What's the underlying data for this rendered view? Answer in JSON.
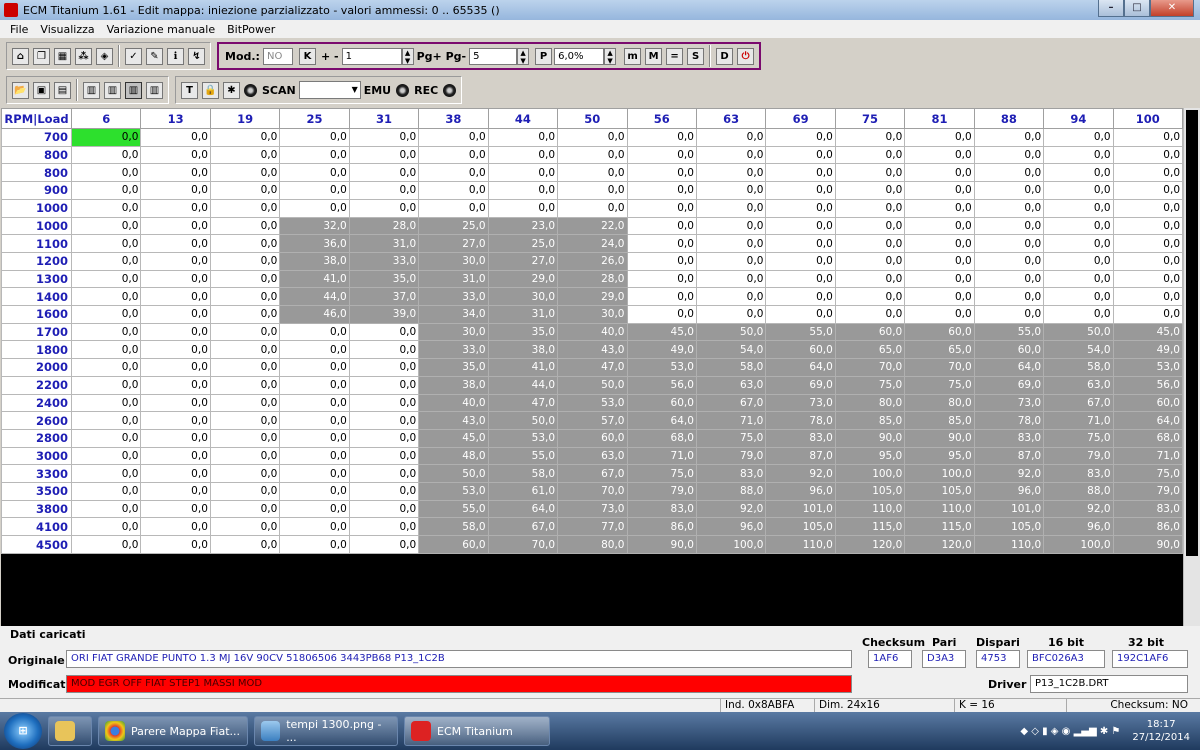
{
  "window": {
    "title": "ECM Titanium 1.61 - Edit mappa: iniezione parzializzato - valori ammessi: 0 .. 65535 ()",
    "min": "–",
    "max": "□",
    "close": "✕"
  },
  "menu": [
    "File",
    "Visualizza",
    "Variazione manuale",
    "BitPower"
  ],
  "toolbar": {
    "mod_label": "Mod.:",
    "mod_value": "NO",
    "k_label": "K",
    "pm_label": "+ -",
    "pm_value": "1",
    "pg_label": "Pg+ Pg-",
    "pg_value": "5",
    "p_label": "P",
    "pct_value": "6,0%",
    "scan_label": "SCAN",
    "emu_label": "EMU",
    "rec_label": "REC"
  },
  "grid": {
    "corner": "RPM|Load",
    "cols": [
      "6",
      "13",
      "19",
      "25",
      "31",
      "38",
      "44",
      "50",
      "56",
      "63",
      "69",
      "75",
      "81",
      "88",
      "94",
      "100"
    ],
    "rpm": [
      "700",
      "800",
      "800",
      "900",
      "1000",
      "1000",
      "1100",
      "1200",
      "1300",
      "1400",
      "1600",
      "1700",
      "1800",
      "2000",
      "2200",
      "2400",
      "2600",
      "2800",
      "3000",
      "3300",
      "3500",
      "3800",
      "4100",
      "4500"
    ],
    "rows": [
      [
        "0,0",
        "0,0",
        "0,0",
        "0,0",
        "0,0",
        "0,0",
        "0,0",
        "0,0",
        "0,0",
        "0,0",
        "0,0",
        "0,0",
        "0,0",
        "0,0",
        "0,0",
        "0,0"
      ],
      [
        "0,0",
        "0,0",
        "0,0",
        "0,0",
        "0,0",
        "0,0",
        "0,0",
        "0,0",
        "0,0",
        "0,0",
        "0,0",
        "0,0",
        "0,0",
        "0,0",
        "0,0",
        "0,0"
      ],
      [
        "0,0",
        "0,0",
        "0,0",
        "0,0",
        "0,0",
        "0,0",
        "0,0",
        "0,0",
        "0,0",
        "0,0",
        "0,0",
        "0,0",
        "0,0",
        "0,0",
        "0,0",
        "0,0"
      ],
      [
        "0,0",
        "0,0",
        "0,0",
        "0,0",
        "0,0",
        "0,0",
        "0,0",
        "0,0",
        "0,0",
        "0,0",
        "0,0",
        "0,0",
        "0,0",
        "0,0",
        "0,0",
        "0,0"
      ],
      [
        "0,0",
        "0,0",
        "0,0",
        "0,0",
        "0,0",
        "0,0",
        "0,0",
        "0,0",
        "0,0",
        "0,0",
        "0,0",
        "0,0",
        "0,0",
        "0,0",
        "0,0",
        "0,0"
      ],
      [
        "0,0",
        "0,0",
        "0,0",
        "32,0",
        "28,0",
        "25,0",
        "23,0",
        "22,0",
        "0,0",
        "0,0",
        "0,0",
        "0,0",
        "0,0",
        "0,0",
        "0,0",
        "0,0"
      ],
      [
        "0,0",
        "0,0",
        "0,0",
        "36,0",
        "31,0",
        "27,0",
        "25,0",
        "24,0",
        "0,0",
        "0,0",
        "0,0",
        "0,0",
        "0,0",
        "0,0",
        "0,0",
        "0,0"
      ],
      [
        "0,0",
        "0,0",
        "0,0",
        "38,0",
        "33,0",
        "30,0",
        "27,0",
        "26,0",
        "0,0",
        "0,0",
        "0,0",
        "0,0",
        "0,0",
        "0,0",
        "0,0",
        "0,0"
      ],
      [
        "0,0",
        "0,0",
        "0,0",
        "41,0",
        "35,0",
        "31,0",
        "29,0",
        "28,0",
        "0,0",
        "0,0",
        "0,0",
        "0,0",
        "0,0",
        "0,0",
        "0,0",
        "0,0"
      ],
      [
        "0,0",
        "0,0",
        "0,0",
        "44,0",
        "37,0",
        "33,0",
        "30,0",
        "29,0",
        "0,0",
        "0,0",
        "0,0",
        "0,0",
        "0,0",
        "0,0",
        "0,0",
        "0,0"
      ],
      [
        "0,0",
        "0,0",
        "0,0",
        "46,0",
        "39,0",
        "34,0",
        "31,0",
        "30,0",
        "0,0",
        "0,0",
        "0,0",
        "0,0",
        "0,0",
        "0,0",
        "0,0",
        "0,0"
      ],
      [
        "0,0",
        "0,0",
        "0,0",
        "0,0",
        "0,0",
        "30,0",
        "35,0",
        "40,0",
        "45,0",
        "50,0",
        "55,0",
        "60,0",
        "60,0",
        "55,0",
        "50,0",
        "45,0"
      ],
      [
        "0,0",
        "0,0",
        "0,0",
        "0,0",
        "0,0",
        "33,0",
        "38,0",
        "43,0",
        "49,0",
        "54,0",
        "60,0",
        "65,0",
        "65,0",
        "60,0",
        "54,0",
        "49,0"
      ],
      [
        "0,0",
        "0,0",
        "0,0",
        "0,0",
        "0,0",
        "35,0",
        "41,0",
        "47,0",
        "53,0",
        "58,0",
        "64,0",
        "70,0",
        "70,0",
        "64,0",
        "58,0",
        "53,0"
      ],
      [
        "0,0",
        "0,0",
        "0,0",
        "0,0",
        "0,0",
        "38,0",
        "44,0",
        "50,0",
        "56,0",
        "63,0",
        "69,0",
        "75,0",
        "75,0",
        "69,0",
        "63,0",
        "56,0"
      ],
      [
        "0,0",
        "0,0",
        "0,0",
        "0,0",
        "0,0",
        "40,0",
        "47,0",
        "53,0",
        "60,0",
        "67,0",
        "73,0",
        "80,0",
        "80,0",
        "73,0",
        "67,0",
        "60,0"
      ],
      [
        "0,0",
        "0,0",
        "0,0",
        "0,0",
        "0,0",
        "43,0",
        "50,0",
        "57,0",
        "64,0",
        "71,0",
        "78,0",
        "85,0",
        "85,0",
        "78,0",
        "71,0",
        "64,0"
      ],
      [
        "0,0",
        "0,0",
        "0,0",
        "0,0",
        "0,0",
        "45,0",
        "53,0",
        "60,0",
        "68,0",
        "75,0",
        "83,0",
        "90,0",
        "90,0",
        "83,0",
        "75,0",
        "68,0"
      ],
      [
        "0,0",
        "0,0",
        "0,0",
        "0,0",
        "0,0",
        "48,0",
        "55,0",
        "63,0",
        "71,0",
        "79,0",
        "87,0",
        "95,0",
        "95,0",
        "87,0",
        "79,0",
        "71,0"
      ],
      [
        "0,0",
        "0,0",
        "0,0",
        "0,0",
        "0,0",
        "50,0",
        "58,0",
        "67,0",
        "75,0",
        "83,0",
        "92,0",
        "100,0",
        "100,0",
        "92,0",
        "83,0",
        "75,0"
      ],
      [
        "0,0",
        "0,0",
        "0,0",
        "0,0",
        "0,0",
        "53,0",
        "61,0",
        "70,0",
        "79,0",
        "88,0",
        "96,0",
        "105,0",
        "105,0",
        "96,0",
        "88,0",
        "79,0"
      ],
      [
        "0,0",
        "0,0",
        "0,0",
        "0,0",
        "0,0",
        "55,0",
        "64,0",
        "73,0",
        "83,0",
        "92,0",
        "101,0",
        "110,0",
        "110,0",
        "101,0",
        "92,0",
        "83,0"
      ],
      [
        "0,0",
        "0,0",
        "0,0",
        "0,0",
        "0,0",
        "58,0",
        "67,0",
        "77,0",
        "86,0",
        "96,0",
        "105,0",
        "115,0",
        "115,0",
        "105,0",
        "96,0",
        "86,0"
      ],
      [
        "0,0",
        "0,0",
        "0,0",
        "0,0",
        "0,0",
        "60,0",
        "70,0",
        "80,0",
        "90,0",
        "100,0",
        "110,0",
        "120,0",
        "120,0",
        "110,0",
        "100,0",
        "90,0"
      ]
    ]
  },
  "panel": {
    "dati_label": "Dati caricati",
    "originale_label": "Originale",
    "originale_value": "ORI FIAT GRANDE PUNTO 1.3 MJ 16V 90CV 51806506 3443PB68 P13_1C2B",
    "modificato_label": "Modificato",
    "modificato_value": "MOD EGR OFF FIAT STEP1 MASSI MOD",
    "checksum_label": "Checksum",
    "checksum_value": "1AF6",
    "pari_label": "Pari",
    "pari_value": "D3A3",
    "dispari_label": "Dispari",
    "dispari_value": "4753",
    "b16_label": "16 bit",
    "b16_value": "BFC026A3",
    "b32_label": "32 bit",
    "b32_value": "192C1AF6",
    "driver_label": "Driver",
    "driver_value": "P13_1C2B.DRT"
  },
  "status": {
    "ind": "Ind. 0x8ABFA",
    "dim": "Dim. 24x16",
    "k": "K = 16",
    "checksum": "Checksum: NO"
  },
  "taskbar": {
    "start": "⊞",
    "item1": "Parere Mappa Fiat...",
    "item2": "tempi 1300.png - ...",
    "item3": "ECM Titanium",
    "time": "18:17",
    "date": "27/12/2014"
  }
}
